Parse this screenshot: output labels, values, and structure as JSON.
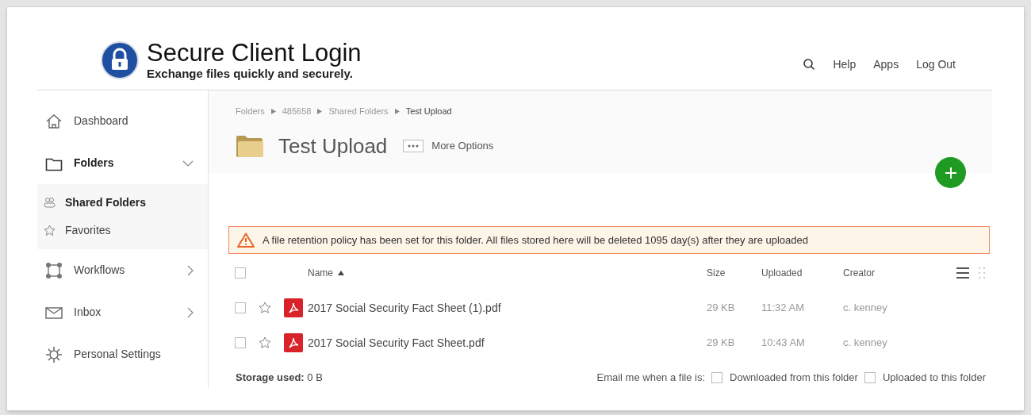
{
  "header": {
    "title": "Secure Client Login",
    "subtitle": "Exchange files quickly and securely.",
    "links": [
      "Help",
      "Apps",
      "Log Out"
    ]
  },
  "sidebar": {
    "items": [
      {
        "label": "Dashboard",
        "has_submenu": false,
        "expanded": false
      },
      {
        "label": "Folders",
        "has_submenu": true,
        "expanded": true,
        "children": [
          {
            "label": "Shared Folders",
            "selected": true
          },
          {
            "label": "Favorites",
            "selected": false
          }
        ]
      },
      {
        "label": "Workflows",
        "has_submenu": true,
        "expanded": false
      },
      {
        "label": "Inbox",
        "has_submenu": true,
        "expanded": false
      },
      {
        "label": "Personal Settings",
        "has_submenu": false,
        "expanded": false
      }
    ]
  },
  "breadcrumb": [
    "Folders",
    "485658",
    "Shared Folders",
    "Test Upload"
  ],
  "folder_title": "Test Upload",
  "more_options": "More Options",
  "alert": "A file retention policy has been set for this folder. All files stored here will be deleted 1095 day(s) after they are uploaded",
  "table": {
    "select_all_checked": false,
    "columns": [
      {
        "label": "Name",
        "sorted": true
      },
      {
        "label": "Size",
        "sorted": false
      },
      {
        "label": "Uploaded",
        "sorted": false
      },
      {
        "label": "Creator",
        "sorted": false
      }
    ],
    "rows": [
      {
        "checked": false,
        "starred": false,
        "name": "2017 Social Security Fact Sheet (1).pdf",
        "size": "29 KB",
        "uploaded": "11:32 AM",
        "creator": "c. kenney"
      },
      {
        "checked": false,
        "starred": false,
        "name": "2017 Social Security Fact Sheet.pdf",
        "size": "29 KB",
        "uploaded": "10:43 AM",
        "creator": "c. kenney"
      }
    ]
  },
  "footer": {
    "storage_label": "Storage used:",
    "storage_value": "0 B",
    "email_label": "Email me when a file is:",
    "options": [
      {
        "label": "Downloaded from this folder",
        "checked": false
      },
      {
        "label": "Uploaded to this folder",
        "checked": false
      }
    ]
  }
}
